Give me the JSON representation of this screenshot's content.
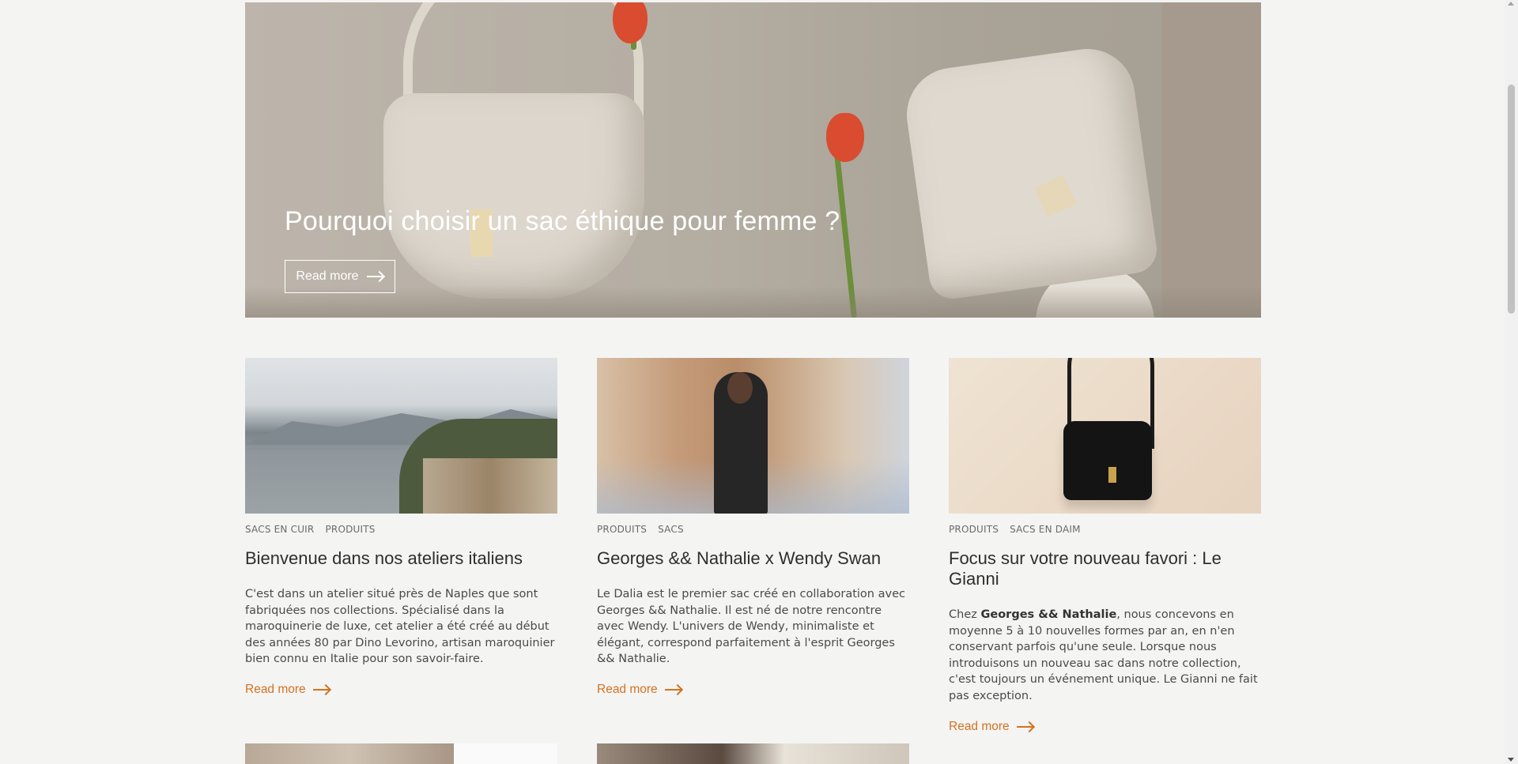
{
  "hero": {
    "title": "Pourquoi choisir un sac éthique pour femme ?",
    "button_label": "Read more"
  },
  "articles": [
    {
      "tags": [
        "SACS EN CUIR",
        "PRODUITS"
      ],
      "title": "Bienvenue dans nos ateliers italiens",
      "excerpt": "C'est dans un atelier situé près de  Naples que sont fabriquées nos collections. Spécialisé dans la maroquinerie de luxe, cet atelier a été créé au début des années 80 par  Dino  Levorino, artisan maroquinier bien connu en  Italie pour son savoir-faire.",
      "read_more": "Read more"
    },
    {
      "tags": [
        "PRODUITS",
        "SACS"
      ],
      "title": "Georges && Nathalie x Wendy Swan",
      "excerpt": "Le  Dalia est le premier sac créé en collaboration avec Georges &&  Nathalie.  Il est né de notre rencontre avec Wendy.  L'univers de Wendy, minimaliste et élégant, correspond parfaitement à l'esprit Georges &&  Nathalie.",
      "read_more": "Read more"
    },
    {
      "tags": [
        "PRODUITS",
        "SACS EN DAIM"
      ],
      "title": "Focus sur votre nouveau favori : Le Gianni",
      "excerpt_prefix": "Chez ",
      "excerpt_bold": "Georges && Nathalie",
      "excerpt_rest": ", nous concevons en moyenne 5 à 10 nouvelles formes par an, en n'en conservant parfois qu'une seule.  Lorsque nous introduisons un nouveau sac dans notre collection, c'est toujours un événement unique. Le Gianni ne fait pas exception.",
      "read_more": "Read more"
    }
  ],
  "colors": {
    "accent": "#d5711f",
    "background": "#f4f4f3"
  }
}
